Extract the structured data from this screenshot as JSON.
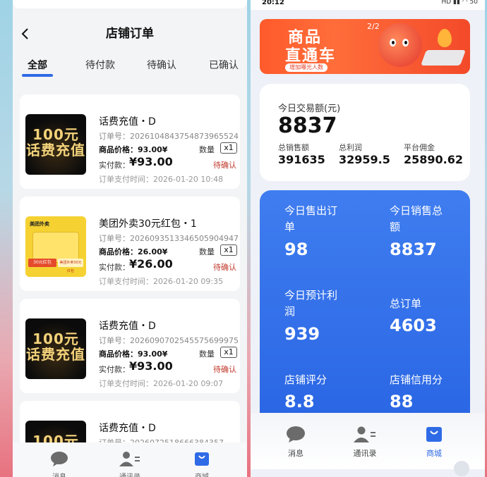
{
  "left": {
    "page_title": "店铺订单",
    "tabs": [
      {
        "label": "全部",
        "active": true
      },
      {
        "label": "待付款",
        "active": false
      },
      {
        "label": "待确认",
        "active": false
      },
      {
        "label": "已确认",
        "active": false
      }
    ],
    "orders": [
      {
        "thumb_text": "100元\n话费充值",
        "title": "话费充值・D",
        "order_no": "订单号：2026104843754873965524",
        "price": "商品价格：93.00¥",
        "qty_label": "数量",
        "qty": "x1",
        "paid_label": "实付款：",
        "paid": "¥93.00",
        "status": "待确认",
        "pay_time": "订单支付时间：2026-01-20 10:48"
      },
      {
        "thumb_text": "美团外卖",
        "thumb_badge": "30元红包",
        "thumb_name": "美团外卖30元红包",
        "title": "美团外卖30元红包・1",
        "order_no": "订单号：2026093513346505904947",
        "price": "商品价格：26.00¥",
        "qty_label": "数量",
        "qty": "x1",
        "paid_label": "实付款：",
        "paid": "¥26.00",
        "status": "待确认",
        "pay_time": "订单支付时间：2026-01-20 09:35"
      },
      {
        "thumb_text": "100元\n话费充值",
        "title": "话费充值・D",
        "order_no": "订单号：2026090702545575699975",
        "price": "商品价格：93.00¥",
        "qty_label": "数量",
        "qty": "x1",
        "paid_label": "实付款：",
        "paid": "¥93.00",
        "status": "待确认",
        "pay_time": "订单支付时间：2026-01-20 09:07"
      },
      {
        "thumb_text": "100元",
        "title": "话费充值・D",
        "order_no": "订单号：2026072518666384357..."
      }
    ],
    "tabbar": [
      {
        "label": "消息",
        "icon": "chat-bubble-icon"
      },
      {
        "label": "通讯录",
        "icon": "contacts-icon"
      },
      {
        "label": "商城",
        "icon": "shopping-bag-icon"
      }
    ]
  },
  "right": {
    "status_bar": {
      "time": "20:12",
      "icons": "HD ▮▮ ◠ 50"
    },
    "banner": {
      "line1": "商品",
      "line2": "直通车",
      "subtitle": "增加曝光人数",
      "page": "2/2"
    },
    "summary": {
      "label": "今日交易额(元)",
      "value": "8837",
      "items": [
        {
          "label": "总销售额",
          "value": "391635"
        },
        {
          "label": "总利润",
          "value": "32959.5"
        },
        {
          "label": "平台佣金",
          "value": "25890.62"
        }
      ]
    },
    "stats": [
      {
        "label_1": "今日售出订",
        "label_2": "单",
        "value": "98"
      },
      {
        "label_1": "今日销售总",
        "label_2": "额",
        "value": "8837"
      },
      {
        "label_1": "今日预计利",
        "label_2": "润",
        "value": "939"
      },
      {
        "label_1": "总订单",
        "label_2": "",
        "value": "4603"
      },
      {
        "label_1": "店铺评分",
        "label_2": "",
        "value": "8.8"
      },
      {
        "label_1": "店铺信用分",
        "label_2": "",
        "value": "88"
      }
    ],
    "tabbar": [
      {
        "label": "消息",
        "icon": "chat-bubble-icon"
      },
      {
        "label": "通讯录",
        "icon": "contacts-icon"
      },
      {
        "label": "商城",
        "icon": "shopping-bag-icon",
        "active": true
      }
    ],
    "colors": {
      "accent": "#2f6be6",
      "stats_bg": "#3a76ec",
      "status_red": "#c0392b"
    }
  }
}
